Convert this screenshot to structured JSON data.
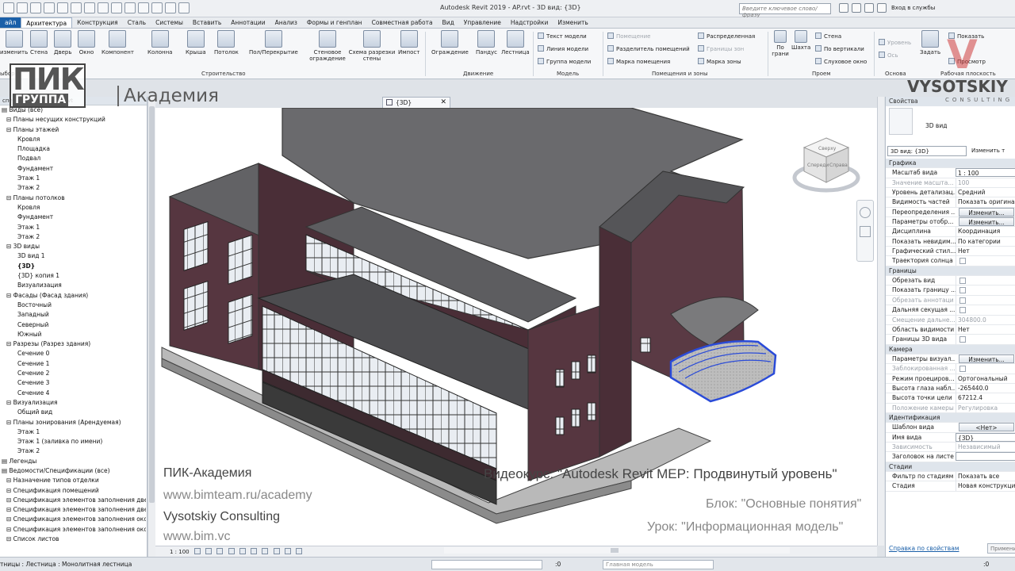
{
  "titlebar": {
    "app_title": "Autodesk Revit 2019 - AP.rvt - 3D вид: {3D}",
    "search_placeholder": "Введите ключевое слово/фразу",
    "signin": "Вход в службы"
  },
  "tabs": [
    "айл",
    "Архитектура",
    "Конструкция",
    "Сталь",
    "Системы",
    "Вставить",
    "Аннотации",
    "Анализ",
    "Формы и генплан",
    "Совместная работа",
    "Вид",
    "Управление",
    "Надстройки",
    "Изменить"
  ],
  "ribbon": {
    "buttons": [
      "изменить",
      "Стена",
      "Дверь",
      "Окно",
      "Компонент",
      "Колонна",
      "Крыша",
      "Потолок",
      "Пол/Перекрытие",
      "Стеновое ограждение",
      "Схема разрезки стены",
      "Импост",
      "Ограждение",
      "Пандус",
      "Лестница"
    ],
    "model": [
      "Текст модели",
      "Линия модели",
      "Группа модели"
    ],
    "rooms": [
      "Помещение",
      "Разделитель помещений",
      "Марка помещения",
      "Распределенная",
      "Границы зон",
      "Марка зоны"
    ],
    "openings": [
      "По грани",
      "Шахта",
      "Стена",
      "По вертикали",
      "Слуховое окно"
    ],
    "datum": [
      "Уровень",
      "Ось"
    ],
    "workplane": [
      "Задать",
      "Показать",
      "Просмотр"
    ],
    "panels": [
      "ыбор",
      "Строительство",
      "Движение",
      "Модель",
      "Помещения и зоны",
      "Проем",
      "Основа",
      "Рабочая плоскость"
    ]
  },
  "branding": {
    "pik": "ПИК",
    "group": "ГРУППА",
    "academy": "Академия",
    "vysotskiy": "VYSOTSKIY",
    "consulting": "CONSULTING"
  },
  "browser": {
    "header": "спетчер проекта - AP.rvt",
    "nodes": [
      {
        "t": "Виды (все)",
        "d": 0
      },
      {
        "t": "Планы несущих конструкций",
        "d": 1
      },
      {
        "t": "Планы этажей",
        "d": 1
      },
      {
        "t": "Кровля",
        "d": 2
      },
      {
        "t": "Площадка",
        "d": 2
      },
      {
        "t": "Подвал",
        "d": 2
      },
      {
        "t": "Фундамент",
        "d": 2
      },
      {
        "t": "Этаж 1",
        "d": 2
      },
      {
        "t": "Этаж 2",
        "d": 2
      },
      {
        "t": "Планы потолков",
        "d": 1
      },
      {
        "t": "Кровля",
        "d": 2
      },
      {
        "t": "Фундамент",
        "d": 2
      },
      {
        "t": "Этаж 1",
        "d": 2
      },
      {
        "t": "Этаж 2",
        "d": 2
      },
      {
        "t": "3D виды",
        "d": 1
      },
      {
        "t": "3D вид 1",
        "d": 2
      },
      {
        "t": "{3D}",
        "d": 2,
        "bold": true
      },
      {
        "t": "{3D} копия 1",
        "d": 2
      },
      {
        "t": "Визуализация",
        "d": 2
      },
      {
        "t": "Фасады (Фасад здания)",
        "d": 1
      },
      {
        "t": "Восточный",
        "d": 2
      },
      {
        "t": "Западный",
        "d": 2
      },
      {
        "t": "Северный",
        "d": 2
      },
      {
        "t": "Южный",
        "d": 2
      },
      {
        "t": "Разрезы (Разрез здания)",
        "d": 1
      },
      {
        "t": "Сечение 0",
        "d": 2
      },
      {
        "t": "Сечение 1",
        "d": 2
      },
      {
        "t": "Сечение 2",
        "d": 2
      },
      {
        "t": "Сечение 3",
        "d": 2
      },
      {
        "t": "Сечение 4",
        "d": 2
      },
      {
        "t": "Визуализация",
        "d": 1
      },
      {
        "t": "Общий вид",
        "d": 2
      },
      {
        "t": "Планы зонирования (Арендуемая)",
        "d": 1
      },
      {
        "t": "Этаж 1",
        "d": 2
      },
      {
        "t": "Этаж 1 (заливка по имени)",
        "d": 2
      },
      {
        "t": "Этаж 2",
        "d": 2
      },
      {
        "t": "Легенды",
        "d": 0
      },
      {
        "t": "Ведомости/Спецификации (все)",
        "d": 0
      },
      {
        "t": "Назначение типов отделки",
        "d": 1
      },
      {
        "t": "Спецификация помещений",
        "d": 1
      },
      {
        "t": "Спецификация элементов заполнения дверн",
        "d": 1
      },
      {
        "t": "Спецификация элементов заполнения дверн",
        "d": 1
      },
      {
        "t": "Спецификация элементов заполнения окон",
        "d": 1
      },
      {
        "t": "Спецификация элементов заполнения окон",
        "d": 1
      },
      {
        "t": "Список листов",
        "d": 1
      }
    ]
  },
  "view": {
    "tab_label": "{3D}",
    "scale": "1 : 100",
    "viewcube": [
      "Сверху",
      "Спереди",
      "Справа"
    ]
  },
  "overlay": {
    "left": [
      "ПИК-Академия",
      "www.bimteam.ru/academy",
      "Vysotskiy Consulting",
      "www.bim.vc"
    ],
    "course": "Видеокурс: \"Autodesk Revit MEP: Продвинутый уровень\"",
    "block": "Блок: \"Основные понятия\"",
    "lesson": "Урок: \"Информационная модель\""
  },
  "status": {
    "text": "тницы : Лестница : Монолитная лестница",
    "workset": "Главная модель",
    "zero": ":0"
  },
  "properties": {
    "header": "Свойства",
    "type_name": "3D вид",
    "selector": "3D вид: {3D}",
    "edit_type": "Изменить т",
    "rows": [
      {
        "g": "Графика"
      },
      {
        "k": "Масштаб вида",
        "v": "1 : 100",
        "box": true
      },
      {
        "k": "Значение масшта...",
        "v": "100",
        "dis": true
      },
      {
        "k": "Уровень детализац...",
        "v": "Средний"
      },
      {
        "k": "Видимость частей",
        "v": "Показать оригинал"
      },
      {
        "k": "Переопределения ...",
        "v": "Изменить...",
        "btn": true
      },
      {
        "k": "Параметры отобр...",
        "v": "Изменить...",
        "btn": true
      },
      {
        "k": "Дисциплина",
        "v": "Координация"
      },
      {
        "k": "Показать невидим...",
        "v": "По категории"
      },
      {
        "k": "Графический стил...",
        "v": "Нет"
      },
      {
        "k": "Траектория солнца",
        "chk": true
      },
      {
        "g": "Границы"
      },
      {
        "k": "Обрезать вид",
        "chk": true
      },
      {
        "k": "Показать границу ...",
        "chk": true
      },
      {
        "k": "Обрезать аннотаци",
        "chk": true,
        "dis": true
      },
      {
        "k": "Дальняя секущая ...",
        "chk": true
      },
      {
        "k": "Смещение дальне...",
        "v": "304800.0",
        "dis": true
      },
      {
        "k": "Область видимости",
        "v": "Нет"
      },
      {
        "k": "Границы 3D вида",
        "chk": true
      },
      {
        "g": "Камера"
      },
      {
        "k": "Параметры визуал...",
        "v": "Изменить...",
        "btn": true
      },
      {
        "k": "Заблокированная ...",
        "chk": true,
        "dis": true
      },
      {
        "k": "Режим проециров...",
        "v": "Ортогональный"
      },
      {
        "k": "Высота глаза набл...",
        "v": "-265440.0"
      },
      {
        "k": "Высота точки цели",
        "v": "67212.4"
      },
      {
        "k": "Положение камеры",
        "v": "Регулировка",
        "dis": true
      },
      {
        "g": "Идентификация"
      },
      {
        "k": "Шаблон вида",
        "v": "<Нет>",
        "btn": true
      },
      {
        "k": "Имя вида",
        "v": "{3D}",
        "box": true
      },
      {
        "k": "Зависимость",
        "v": "Независимый",
        "dis": true
      },
      {
        "k": "Заголовок на листе",
        "v": "",
        "box": true
      },
      {
        "g": "Стадии"
      },
      {
        "k": "Фильтр по стадиям",
        "v": "Показать все"
      },
      {
        "k": "Стадия",
        "v": "Новая конструкция"
      }
    ],
    "help": "Справка по свойствам",
    "apply": "Примени"
  },
  "colors": {
    "accent": "#1a5fa8",
    "wall": "#5a3a44",
    "roof": "#5f5f62",
    "selection": "#2a4bd8"
  }
}
